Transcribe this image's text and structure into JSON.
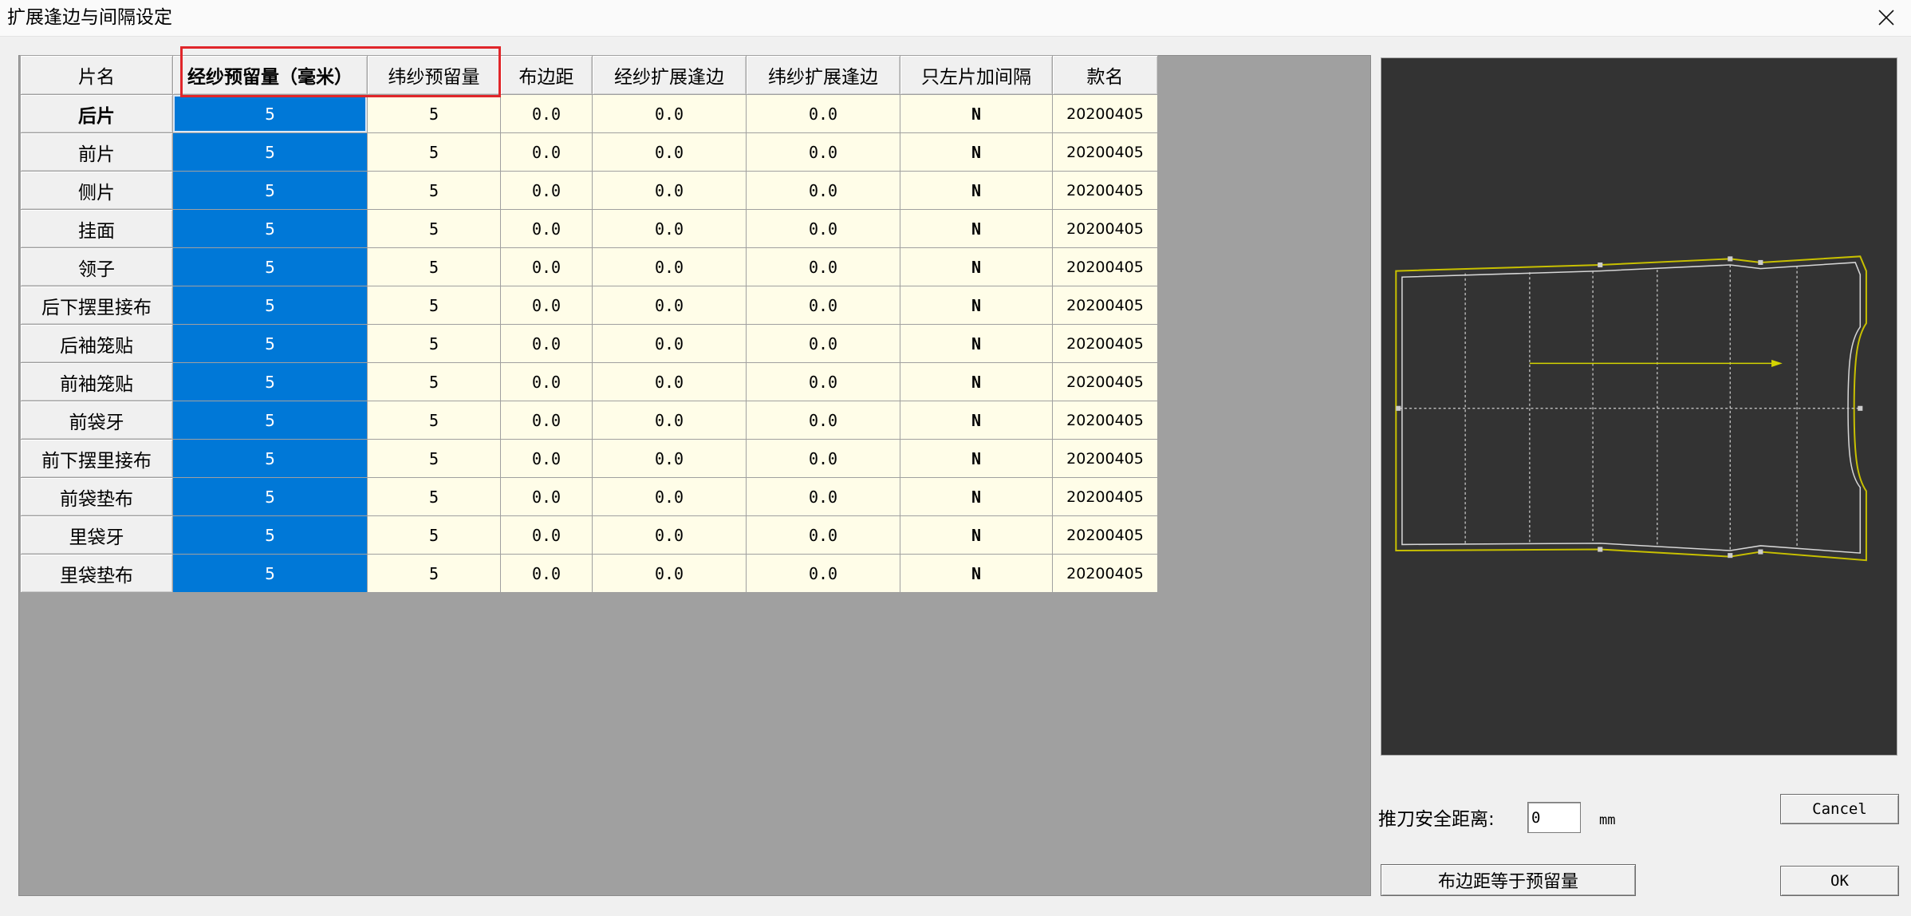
{
  "window": {
    "title": "扩展逢边与间隔设定",
    "close_icon": "close-icon"
  },
  "table": {
    "columns": [
      "片名",
      "经纱预留量（毫米）",
      "纬纱预留量",
      "布边距",
      "经纱扩展逢边",
      "纬纱扩展逢边",
      "只左片加间隔",
      "款名"
    ],
    "selected_column": 1,
    "current_row": 0,
    "rows": [
      {
        "name": "后片",
        "warp": "5",
        "weft": "5",
        "selvedge": "0.0",
        "warp_ext": "0.0",
        "weft_ext": "0.0",
        "left_only": "N",
        "style": "20200405"
      },
      {
        "name": "前片",
        "warp": "5",
        "weft": "5",
        "selvedge": "0.0",
        "warp_ext": "0.0",
        "weft_ext": "0.0",
        "left_only": "N",
        "style": "20200405"
      },
      {
        "name": "侧片",
        "warp": "5",
        "weft": "5",
        "selvedge": "0.0",
        "warp_ext": "0.0",
        "weft_ext": "0.0",
        "left_only": "N",
        "style": "20200405"
      },
      {
        "name": "挂面",
        "warp": "5",
        "weft": "5",
        "selvedge": "0.0",
        "warp_ext": "0.0",
        "weft_ext": "0.0",
        "left_only": "N",
        "style": "20200405"
      },
      {
        "name": "领子",
        "warp": "5",
        "weft": "5",
        "selvedge": "0.0",
        "warp_ext": "0.0",
        "weft_ext": "0.0",
        "left_only": "N",
        "style": "20200405"
      },
      {
        "name": "后下摆里接布",
        "warp": "5",
        "weft": "5",
        "selvedge": "0.0",
        "warp_ext": "0.0",
        "weft_ext": "0.0",
        "left_only": "N",
        "style": "20200405"
      },
      {
        "name": "后袖笼贴",
        "warp": "5",
        "weft": "5",
        "selvedge": "0.0",
        "warp_ext": "0.0",
        "weft_ext": "0.0",
        "left_only": "N",
        "style": "20200405"
      },
      {
        "name": "前袖笼贴",
        "warp": "5",
        "weft": "5",
        "selvedge": "0.0",
        "warp_ext": "0.0",
        "weft_ext": "0.0",
        "left_only": "N",
        "style": "20200405"
      },
      {
        "name": "前袋牙",
        "warp": "5",
        "weft": "5",
        "selvedge": "0.0",
        "warp_ext": "0.0",
        "weft_ext": "0.0",
        "left_only": "N",
        "style": "20200405"
      },
      {
        "name": "前下摆里接布",
        "warp": "5",
        "weft": "5",
        "selvedge": "0.0",
        "warp_ext": "0.0",
        "weft_ext": "0.0",
        "left_only": "N",
        "style": "20200405"
      },
      {
        "name": "前袋垫布",
        "warp": "5",
        "weft": "5",
        "selvedge": "0.0",
        "warp_ext": "0.0",
        "weft_ext": "0.0",
        "left_only": "N",
        "style": "20200405"
      },
      {
        "name": "里袋牙",
        "warp": "5",
        "weft": "5",
        "selvedge": "0.0",
        "warp_ext": "0.0",
        "weft_ext": "0.0",
        "left_only": "N",
        "style": "20200405"
      },
      {
        "name": "里袋垫布",
        "warp": "5",
        "weft": "5",
        "selvedge": "0.0",
        "warp_ext": "0.0",
        "weft_ext": "0.0",
        "left_only": "N",
        "style": "20200405"
      }
    ]
  },
  "controls": {
    "knife_safety_label": "推刀安全距离:",
    "knife_safety_value": "0",
    "knife_safety_unit": "mm",
    "cancel_label": "Cancel",
    "equalize_label": "布边距等于预留量",
    "ok_label": "OK"
  },
  "colors": {
    "selected_column": "#0078d7",
    "cell_background": "#fffde8",
    "highlight_box": "#e0262a",
    "preview_background": "#333333",
    "seam_outline": "#c8c000"
  }
}
